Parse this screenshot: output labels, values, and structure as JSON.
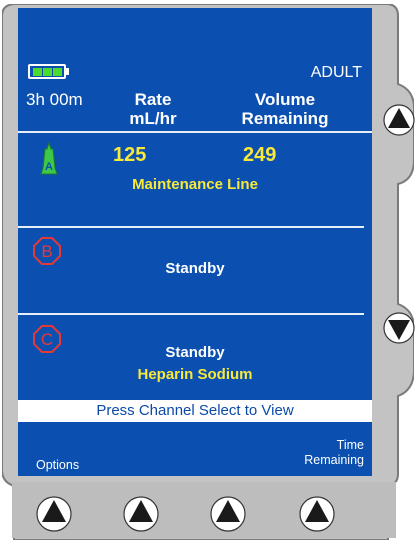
{
  "header": {
    "profile": "ADULT",
    "time_remaining": "3h 00m",
    "rate_label_1": "Rate",
    "rate_label_2": "mL/hr",
    "volume_label_1": "Volume",
    "volume_label_2": "Remaining"
  },
  "battery": {
    "level": 1.0
  },
  "channels": [
    {
      "letter": "A",
      "rate": "125",
      "volume": "249",
      "status": "Maintenance Line",
      "color": "#3ec84a"
    },
    {
      "letter": "B",
      "status": "Standby",
      "color": "#e53935"
    },
    {
      "letter": "C",
      "status": "Standby",
      "drug": "Heparin Sodium",
      "color": "#e53935"
    }
  ],
  "banner": "Press Channel Select to View",
  "softkeys": {
    "left_label": "Options",
    "right_label_1": "Time",
    "right_label_2": "Remaining"
  },
  "colors": {
    "screen": "#0b50b0",
    "accent_yellow": "#f7e83a",
    "battery": "#4ddc2d"
  }
}
